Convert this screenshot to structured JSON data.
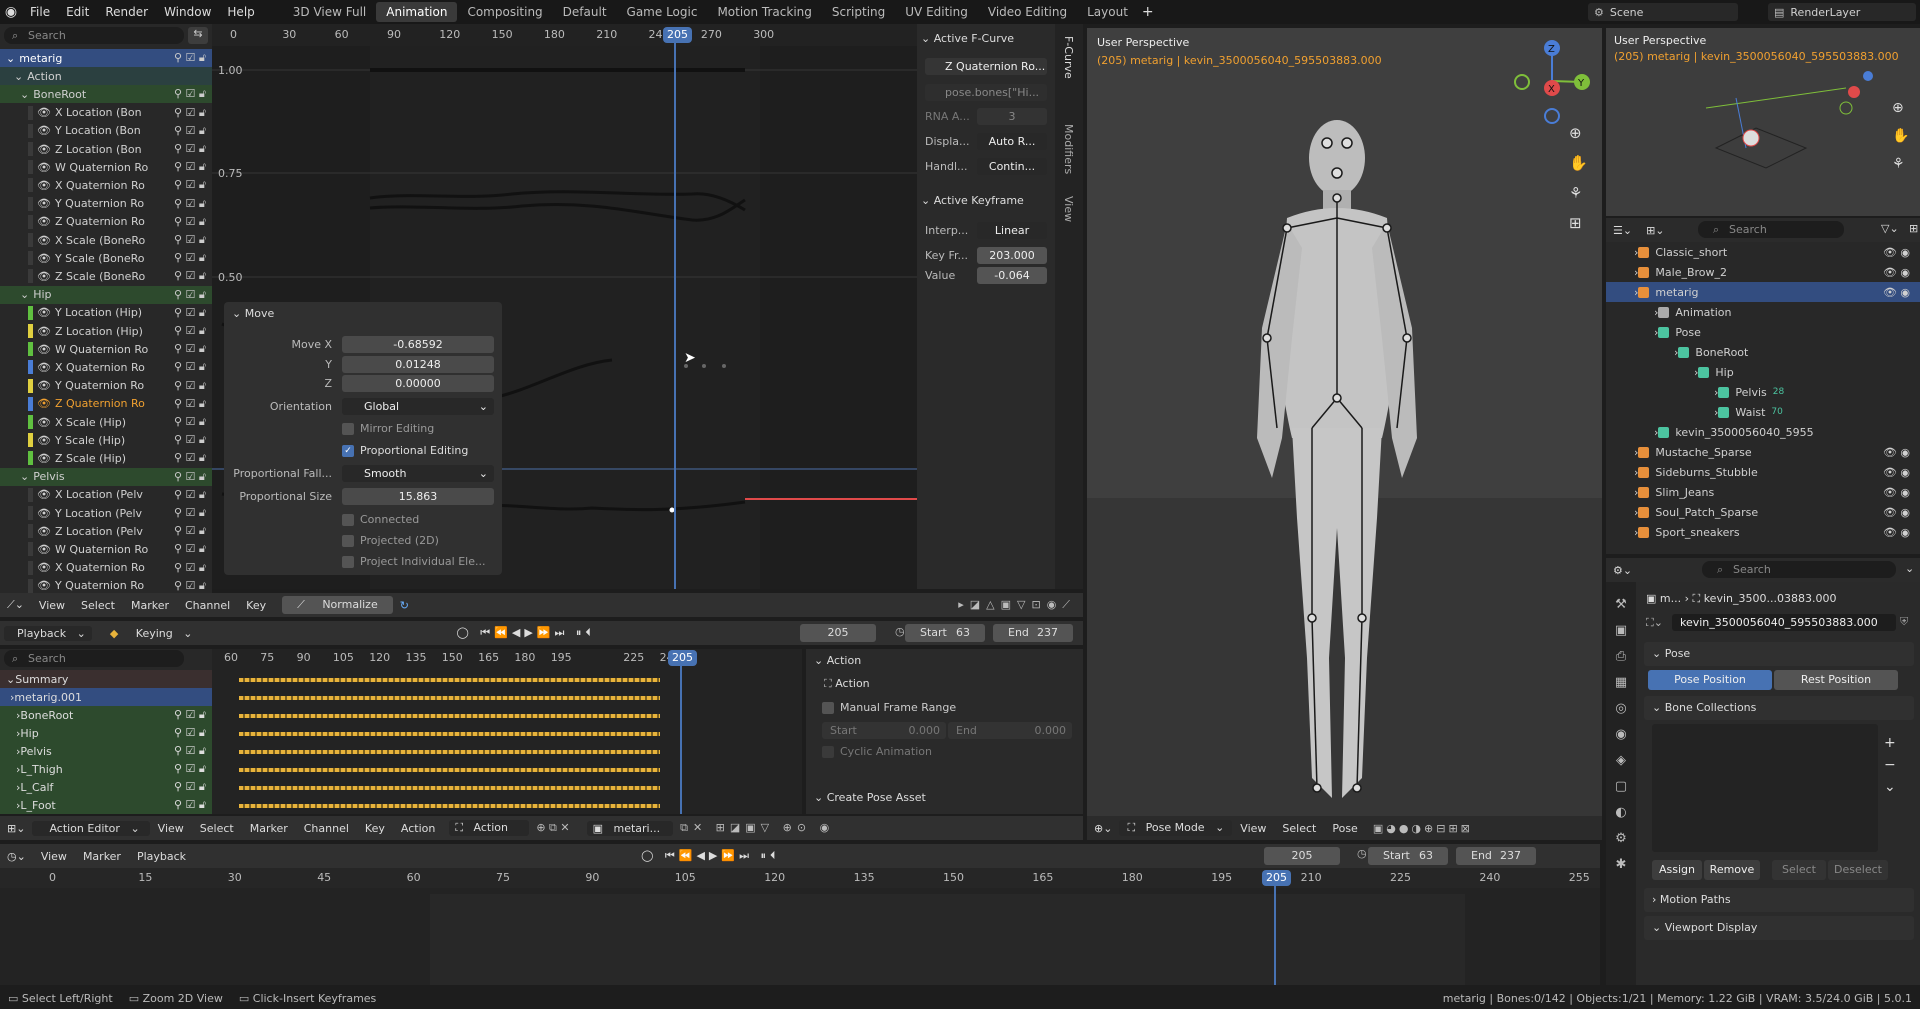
{
  "topbar": {
    "menus": [
      "File",
      "Edit",
      "Render",
      "Window",
      "Help"
    ],
    "workspaces": [
      "3D View Full",
      "Animation",
      "Compositing",
      "Default",
      "Game Logic",
      "Motion Tracking",
      "Scripting",
      "UV Editing",
      "Video Editing",
      "Layout"
    ],
    "active_workspace": "Animation",
    "add": "+",
    "scene": "Scene",
    "view_layer": "RenderLayer"
  },
  "graph": {
    "search_placeholder": "Search",
    "ticks": [
      "0",
      "30",
      "60",
      "90",
      "120",
      "150",
      "180",
      "205",
      "210",
      "240",
      "270",
      "300"
    ],
    "frame": "205",
    "yticks": [
      "1.00",
      "0.75",
      "0.50"
    ],
    "channels": [
      {
        "label": "metarig",
        "type": "object"
      },
      {
        "label": "Action",
        "type": "action"
      },
      {
        "label": "BoneRoot",
        "type": "group"
      },
      {
        "label": "X Location (Bon",
        "type": "fc"
      },
      {
        "label": "Y Location (Bon",
        "type": "fc"
      },
      {
        "label": "Z Location (Bon",
        "type": "fc"
      },
      {
        "label": "W Quaternion Ro",
        "type": "fc"
      },
      {
        "label": "X Quaternion Ro",
        "type": "fc"
      },
      {
        "label": "Y Quaternion Ro",
        "type": "fc"
      },
      {
        "label": "Z Quaternion Ro",
        "type": "fc"
      },
      {
        "label": "X Scale (BoneRo",
        "type": "fc"
      },
      {
        "label": "Y Scale (BoneRo",
        "type": "fc"
      },
      {
        "label": "Z Scale (BoneRo",
        "type": "fc"
      },
      {
        "label": "Hip",
        "type": "group"
      },
      {
        "label": "Y Location (Hip)",
        "type": "fcv"
      },
      {
        "label": "Z Location (Hip)",
        "type": "fcv"
      },
      {
        "label": "W Quaternion Ro",
        "type": "fcv"
      },
      {
        "label": "X Quaternion Ro",
        "type": "fcv"
      },
      {
        "label": "Y Quaternion Ro",
        "type": "fcv"
      },
      {
        "label": "Z Quaternion Ro",
        "type": "fcsel"
      },
      {
        "label": "X Scale (Hip)",
        "type": "fcv"
      },
      {
        "label": "Y Scale (Hip)",
        "type": "fcv"
      },
      {
        "label": "Z Scale (Hip)",
        "type": "fcv"
      },
      {
        "label": "Pelvis",
        "type": "group"
      },
      {
        "label": "X Location (Pelv",
        "type": "fc"
      },
      {
        "label": "Y Location (Pelv",
        "type": "fc"
      },
      {
        "label": "Z Location (Pelv",
        "type": "fc"
      },
      {
        "label": "W Quaternion Ro",
        "type": "fc"
      },
      {
        "label": "X Quaternion Ro",
        "type": "fc"
      },
      {
        "label": "Y Quaternion Ro",
        "type": "fc"
      }
    ],
    "footer": {
      "menus": [
        "View",
        "Select",
        "Marker",
        "Channel",
        "Key"
      ],
      "normalize": "Normalize"
    }
  },
  "move_panel": {
    "title": "Move",
    "move_x_label": "Move X",
    "move_x": "-0.68592",
    "y_label": "Y",
    "y": "0.01248",
    "z_label": "Z",
    "z": "0.00000",
    "orientation_label": "Orientation",
    "orientation": "Global",
    "mirror": "Mirror Editing",
    "prop_edit": "Proportional Editing",
    "falloff_label": "Proportional Fall...",
    "falloff": "Smooth",
    "size_label": "Proportional Size",
    "size": "15.863",
    "connected": "Connected",
    "projected": "Projected (2D)",
    "project_indiv": "Project Individual Ele..."
  },
  "fcurve_panel": {
    "section1": "Active F-Curve",
    "curve_name": "Z Quaternion Ro...",
    "data_path": "pose.bones[\"Hi...",
    "rna_label": "RNA A...",
    "rna_value": "3",
    "display_label": "Displa...",
    "display_value": "Auto R...",
    "handle_label": "Handl...",
    "handle_value": "Contin...",
    "section2": "Active Keyframe",
    "interp_label": "Interp...",
    "interp_value": "Linear",
    "keyframe_label": "Key Fr...",
    "keyframe_value": "203.000",
    "value_label": "Value",
    "value": "-0.064",
    "tabs": [
      "F-Curve",
      "Modifiers",
      "View"
    ]
  },
  "viewport": {
    "title": "User Perspective",
    "subtitle": "(205) metarig | kevin_3500056040_595503883.000",
    "axes": {
      "x": "X",
      "y": "Y",
      "z": "Z"
    },
    "footer": {
      "mode": "Pose Mode",
      "menus": [
        "View",
        "Select",
        "Pose"
      ]
    }
  },
  "mini_viewport": {
    "title": "User Perspective",
    "subtitle": "(205) metarig | kevin_3500056040_595503883.000"
  },
  "outliner": {
    "search_placeholder": "Search",
    "items": [
      {
        "label": "Classic_short",
        "indent": 0,
        "color": "#e8903b"
      },
      {
        "label": "Male_Brow_2",
        "indent": 0,
        "color": "#e8903b"
      },
      {
        "label": "metarig",
        "indent": 0,
        "color": "#e8903b",
        "selected": true
      },
      {
        "label": "Animation",
        "indent": 1,
        "color": "#aaa"
      },
      {
        "label": "Pose",
        "indent": 1,
        "color": "#4cc4a0"
      },
      {
        "label": "BoneRoot",
        "indent": 2,
        "color": "#4cc4a0"
      },
      {
        "label": "Hip",
        "indent": 3,
        "color": "#4cc4a0"
      },
      {
        "label": "Pelvis",
        "indent": 4,
        "color": "#4cc4a0",
        "extra": "28"
      },
      {
        "label": "Waist",
        "indent": 4,
        "color": "#4cc4a0",
        "extra": "70"
      },
      {
        "label": "kevin_3500056040_5955",
        "indent": 1,
        "color": "#4cc4a0"
      },
      {
        "label": "Mustache_Sparse",
        "indent": 0,
        "color": "#e8903b"
      },
      {
        "label": "Sideburns_Stubble",
        "indent": 0,
        "color": "#e8903b"
      },
      {
        "label": "Slim_Jeans",
        "indent": 0,
        "color": "#e8903b"
      },
      {
        "label": "Soul_Patch_Sparse",
        "indent": 0,
        "color": "#e8903b"
      },
      {
        "label": "Sport_sneakers",
        "indent": 0,
        "color": "#e8903b"
      }
    ]
  },
  "properties": {
    "search_placeholder": "Search",
    "crumb1": "m...",
    "crumb2": "kevin_3500...03883.000",
    "bone_name": "kevin_3500056040_595503883.000",
    "pose_section": "Pose",
    "pose_position": "Pose Position",
    "rest_position": "Rest Position",
    "bone_collections": "Bone Collections",
    "assign": "Assign",
    "remove": "Remove",
    "select": "Select",
    "deselect": "Deselect",
    "motion_paths": "Motion Paths",
    "viewport_display": "Viewport Display"
  },
  "dopesheet": {
    "playback": "Playback",
    "keying": "Keying",
    "frame": "205",
    "start_label": "Start",
    "start": "63",
    "end_label": "End",
    "end": "237",
    "search_placeholder": "Search",
    "ticks": [
      "60",
      "75",
      "90",
      "105",
      "120",
      "135",
      "150",
      "165",
      "180",
      "195",
      "205",
      "225",
      "240"
    ],
    "channels": [
      {
        "label": "Summary",
        "type": "summary"
      },
      {
        "label": "metarig.001",
        "type": "object"
      },
      {
        "label": "BoneRoot",
        "type": "group"
      },
      {
        "label": "Hip",
        "type": "group"
      },
      {
        "label": "Pelvis",
        "type": "group"
      },
      {
        "label": "L_Thigh",
        "type": "group"
      },
      {
        "label": "L_Calf",
        "type": "group"
      },
      {
        "label": "L_Foot",
        "type": "group"
      }
    ],
    "footer": {
      "editor": "Action Editor",
      "menus": [
        "View",
        "Select",
        "Marker",
        "Channel",
        "Key",
        "Action"
      ],
      "action_name": "Action",
      "object": "metari..."
    }
  },
  "action_panel": {
    "title": "Action",
    "action": "Action",
    "manual_range": "Manual Frame Range",
    "start_label": "Start",
    "start": "0.000",
    "end_label": "End",
    "end": "0.000",
    "cyclic": "Cyclic Animation",
    "create_pose": "Create Pose Asset"
  },
  "timeline": {
    "menus": [
      "View",
      "Marker",
      "Playback"
    ],
    "frame": "205",
    "start_label": "Start",
    "start": "63",
    "end_label": "End",
    "end": "237",
    "ticks": [
      "0",
      "15",
      "30",
      "45",
      "60",
      "75",
      "90",
      "105",
      "120",
      "135",
      "150",
      "165",
      "180",
      "195",
      "205",
      "210",
      "225",
      "240",
      "255"
    ]
  },
  "statusbar": {
    "hints": [
      "Select Left/Right",
      "Zoom 2D View",
      "Click-Insert Keyframes"
    ],
    "stats": "metarig | Bones:0/142 | Objects:1/21 | Memory: 1.22 GiB | VRAM: 3.5/24.0 GiB | 5.0.1"
  },
  "colors": {
    "accent": "#4772b3",
    "keyframe": "#e8b33b",
    "selected_text": "#f0a030",
    "outliner_selected": "#334d80"
  }
}
